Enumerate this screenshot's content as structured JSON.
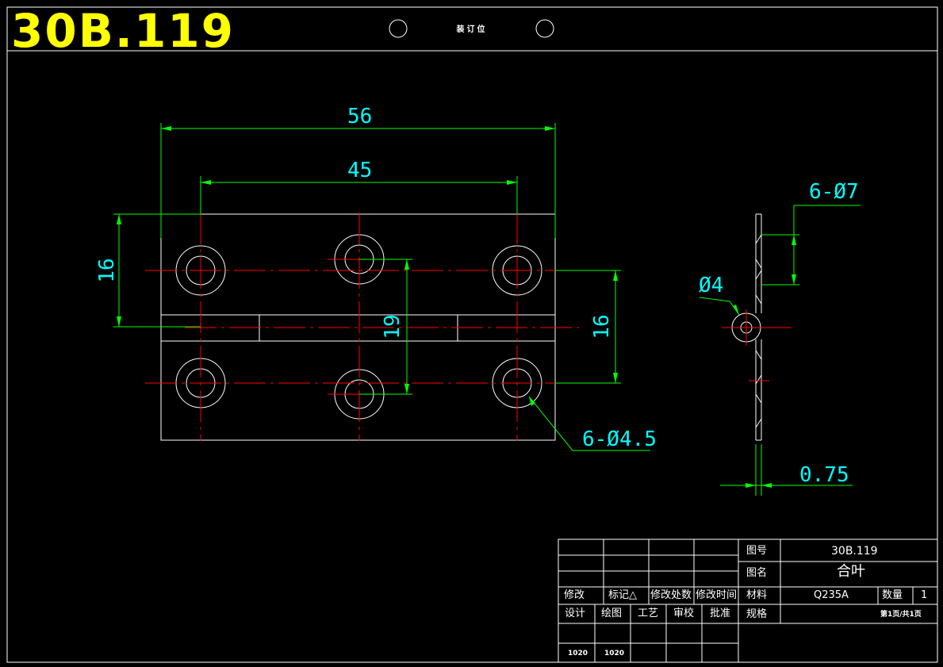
{
  "drawing": {
    "title_code": "30B.119",
    "binding_label": "装订位"
  },
  "dimensions": {
    "width_overall": "56",
    "hole_spacing": "45",
    "left_height": "16",
    "center_height": "19",
    "right_height": "16",
    "holes_callout": "6-Ø4.5",
    "side_holes_callout": "6-Ø7",
    "pin_diameter": "Ø4",
    "thickness": "0.75"
  },
  "title_block": {
    "revision_headers": [
      "修改",
      "标记△",
      "修改处数",
      "修改时间"
    ],
    "sign_headers": [
      "设计",
      "绘图",
      "工艺",
      "审校",
      "批准"
    ],
    "design_code": "1020",
    "draw_code": "1020",
    "drawing_no_label": "图号",
    "drawing_no": "30B.119",
    "name_label": "图名",
    "name": "合叶",
    "material_label": "材料",
    "material": "Q235A",
    "qty_label": "数量",
    "qty": "1",
    "spec_label": "规格",
    "sheet": "第1页/共1页"
  },
  "colors": {
    "background": "#000000",
    "outline": "#ffffff",
    "dimension": "#00ff00",
    "centerline": "#ff0000",
    "text_dim": "#00ffff",
    "title": "#ffff00"
  }
}
